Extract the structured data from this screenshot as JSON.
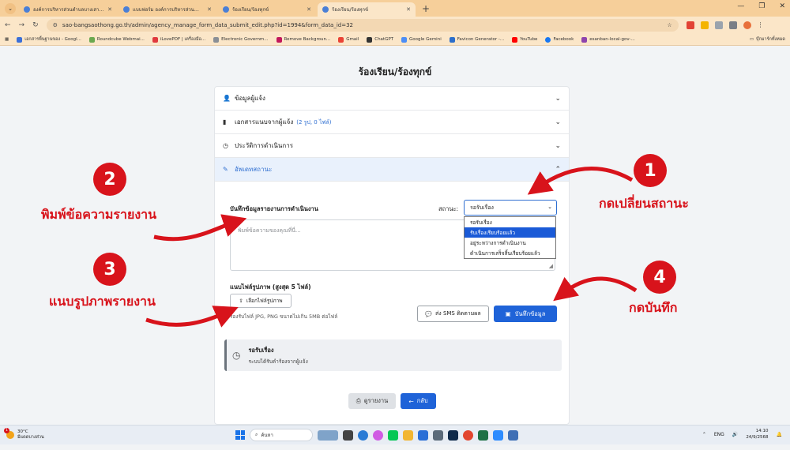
{
  "browser": {
    "tabs": [
      {
        "title": "องค์การบริหารส่วนตำบลบางเสาธง อ.บ"
      },
      {
        "title": "แบบฟอร์ม องค์การบริหารส่วนตำบลบ"
      },
      {
        "title": "ร้องเรียน/ร้องทุกข์"
      },
      {
        "title": "ร้องเรียน/ร้องทุกข์"
      }
    ],
    "active_tab": 3,
    "url": "sao-bangsaothong.go.th/admin/agency_manage_form_data_submit_edit.php?id=1994&form_data_id=32",
    "bookmarks": [
      "เอกสารพื้นฐานของ - Googl...",
      "Roundcube Webmai...",
      "iLovePDF | เครื่องมือ...",
      "Electronic Governm...",
      "Remove Backgroun...",
      "Gmail",
      "ChatGPT",
      "Google Gemini",
      "Favicon Generator -...",
      "YouTube",
      "Facebook",
      "esanban-local-gov-..."
    ],
    "bookmarks_all": "บุ๊กมาร์กทั้งหมด",
    "new_tab": "+"
  },
  "page": {
    "title": "ร้องเรียน/ร้องทุกข์",
    "sections": [
      {
        "label": "ข้อมูลผู้แจ้ง",
        "sub": ""
      },
      {
        "label": "เอกสารแนบจากผู้แจ้ง",
        "sub": "(2 รูป, 0 ไฟล์)"
      },
      {
        "label": "ประวัติการดำเนินการ",
        "sub": ""
      },
      {
        "label": "อัพเดทสถานะ",
        "sub": ""
      }
    ],
    "report_label": "บันทึกข้อมูลรายงานการดำเนินงาน",
    "status_label": "สถานะ:",
    "status_selected": "รอรับเรื่อง",
    "status_options": [
      "รอรับเรื่อง",
      "รับเรื่องเรียบร้อยแล้ว",
      "อยู่ระหว่างการดำเนินงาน",
      "ดำเนินการเสร็จสิ้นเรียบร้อยแล้ว"
    ],
    "status_highlighted": 1,
    "textarea_placeholder": "พิมพ์ข้อความของคุณที่นี่...",
    "file_label": "แนบไฟล์รูปภาพ (สูงสุด 5 ไฟล์)",
    "file_button": "เลือกไฟล์รูปภาพ",
    "file_hint": "รองรับไฟล์ JPG, PNG ขนาดไม่เกิน 5MB ต่อไฟล์",
    "sms_button": "ส่ง SMS ติดตามผล",
    "save_button": "บันทึกข้อมูล",
    "current_status_title": "รอรับเรื่อง",
    "current_status_desc": "ระบบได้รับคำร้องจากผู้แจ้ง",
    "print_button": "ดูรายงาน",
    "back_button": "กลับ"
  },
  "annotations": [
    {
      "number": "1",
      "text": "กดเปลี่ยนสถานะ"
    },
    {
      "number": "2",
      "text": "พิมพ์ข้อความรายงาน"
    },
    {
      "number": "3",
      "text": "แนบรูปภาพรายงาน"
    },
    {
      "number": "4",
      "text": "กดบันทึก"
    }
  ],
  "taskbar": {
    "weather_temp": "30°C",
    "weather_desc": "มีแดดบางส่วน",
    "search_placeholder": "ค้นหา",
    "lang": "ENG",
    "time": "14:10",
    "date": "24/9/2568",
    "notif_count": "1"
  },
  "colors": {
    "accent": "#1f63d8",
    "annotation": "#d8131b",
    "tabbar": "#f6cf9a"
  }
}
